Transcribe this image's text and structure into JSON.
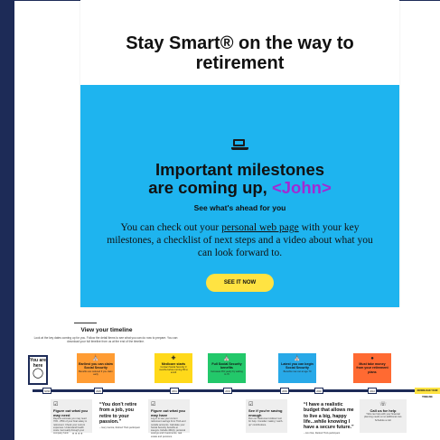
{
  "email": {
    "headline_line1": "Stay Smart® on the way to",
    "headline_line2": "retirement",
    "hero": {
      "icon": "laptop-icon",
      "milestone_line1": "Important milestones",
      "milestone_line2": "are coming up,",
      "name_token": "<John>",
      "subheading": "See what's ahead for you",
      "body_before": "You can check out your",
      "body_link": "personal web page",
      "body_after": "with your key milestones, a checklist of next steps and a video about what you can look forward to.",
      "cta": "SEE IT NOW"
    },
    "colors": {
      "hero_bg": "#1eb4ef",
      "name_token": "#a12bd3",
      "cta_bg": "#ffe342"
    }
  },
  "timeline": {
    "title": "View your timeline",
    "intro": "Look at the key dates coming up for you. Follow the detail items to see what you can do now to prepare. You can download your full timeline from us at the end of the timeline.",
    "you_are_here": "You are here",
    "you_icon": "person-icon",
    "cards": [
      {
        "icon": "bank-icon",
        "title": "Earliest you can claim Social Security",
        "note": "Benefits are reduced if you claim early",
        "color": "#ff9c33"
      },
      {
        "icon": "medical-icon",
        "title": "Medicare starts",
        "note": "Contact Social Security 3 months before turning 65 to enroll",
        "color": "#ffd91a"
      },
      {
        "icon": "bank-icon",
        "title": "Full Social Security benefits",
        "note": "Increases 8% yearly by waiting to 70",
        "color": "#23c86a"
      },
      {
        "icon": "bank-icon",
        "title": "Latest you can begin Social Security",
        "note": "Benefits max out at age 70",
        "color": "#28a9e8"
      },
      {
        "icon": "coin-icon",
        "title": "Must take money from your retirement plans",
        "note": "",
        "color": "#ff6a32"
      }
    ],
    "ticks": [
      "NOW",
      "2029",
      "2031",
      "2033",
      "2036",
      "2040",
      "2044"
    ],
    "end_label": "DOWNLOAD YOUR TIMELINE",
    "steps": [
      {
        "icon": "checklist-icon",
        "title": "Figure out what you may need",
        "text": "Reports estimate you may need 70% - 85% of your final salary in retirement. Check your current expenses. Understand health costs. Get ready through your company fund."
      },
      {
        "icon": "checklist-icon",
        "title": "Figure out what you may have",
        "text": "Log in to see your current retirement savings from TIAA and outside accounts. Calculate your Social Security benefits at ssa.gov. Include 401(k), personal savings and investments, real estate and pensions."
      },
      {
        "icon": "checklist-icon",
        "title": "See if you're saving enough",
        "text": "Run our Retirement Advisor tool for help. Consider making “catch-up” contributions."
      },
      {
        "icon": "phone-icon",
        "title": "Call us for help",
        "text": "TIAA can help with your financial planning needs at no additional cost. Schedule a call."
      }
    ],
    "quotes": [
      {
        "text": "“You don’t retire from a job, you retire to your passion.”",
        "by": "– Gary Garcia, Retired TIAA participant"
      },
      {
        "text": "“I have a realistic budget that allows me to live a big, happy life...while knowing I have a secure future.”",
        "by": "– Ann Nat, Retired TIAA participant"
      }
    ],
    "pager": "••••"
  }
}
